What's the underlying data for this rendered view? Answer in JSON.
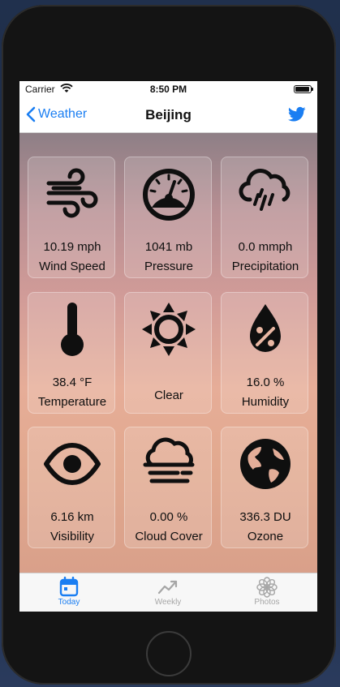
{
  "status": {
    "carrier": "Carrier",
    "time": "8:50 PM"
  },
  "nav": {
    "back_label": "Weather",
    "title": "Beijing"
  },
  "tiles": [
    {
      "value": "10.19 mph",
      "label": "Wind Speed",
      "icon": "wind-icon"
    },
    {
      "value": "1041 mb",
      "label": "Pressure",
      "icon": "gauge-icon"
    },
    {
      "value": "0.0 mmph",
      "label": "Precipitation",
      "icon": "rain-cloud-icon"
    },
    {
      "value": "38.4 °F",
      "label": "Temperature",
      "icon": "thermometer-icon"
    },
    {
      "value": "",
      "label": "Clear",
      "icon": "sun-icon"
    },
    {
      "value": "16.0 %",
      "label": "Humidity",
      "icon": "humidity-drop-icon"
    },
    {
      "value": "6.16 km",
      "label": "Visibility",
      "icon": "eye-icon"
    },
    {
      "value": "0.00 %",
      "label": "Cloud Cover",
      "icon": "fog-cloud-icon"
    },
    {
      "value": "336.3 DU",
      "label": "Ozone",
      "icon": "globe-icon"
    }
  ],
  "tabs": [
    {
      "label": "Today",
      "icon": "calendar-icon",
      "active": true
    },
    {
      "label": "Weekly",
      "icon": "trend-icon",
      "active": false
    },
    {
      "label": "Photos",
      "icon": "flower-icon",
      "active": false
    }
  ],
  "colors": {
    "accent": "#1a7ef2",
    "inactive": "#a6a6a6",
    "icon": "#0f0f0f"
  }
}
